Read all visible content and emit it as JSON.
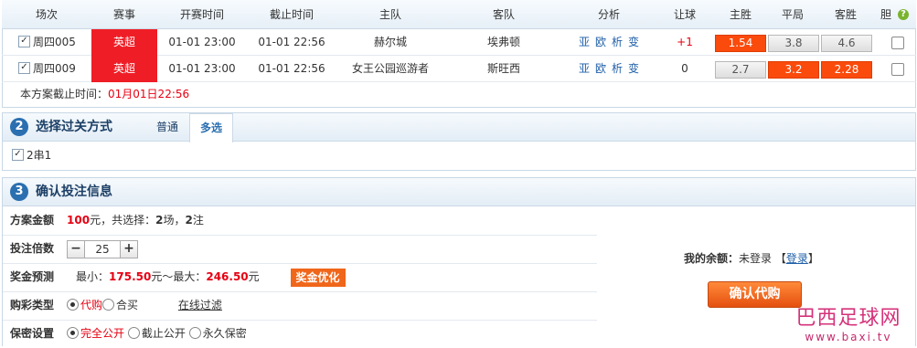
{
  "table": {
    "headers": [
      "场次",
      "赛事",
      "开赛时间",
      "截止时间",
      "主队",
      "客队",
      "分析",
      "让球",
      "主胜",
      "平局",
      "客胜",
      "胆"
    ],
    "rows": [
      {
        "match_no": "周四005",
        "league": "英超",
        "start": "01-01 23:00",
        "deadline": "01-01 22:56",
        "home": "赫尔城",
        "away": "埃弗顿",
        "analysis": [
          "亚",
          "欧",
          "析",
          "变"
        ],
        "handicap": "+1",
        "win": "1.54",
        "draw": "3.8",
        "lose": "4.6",
        "selected": [
          "win"
        ]
      },
      {
        "match_no": "周四009",
        "league": "英超",
        "start": "01-01 23:00",
        "deadline": "01-01 22:56",
        "home": "女王公园巡游者",
        "away": "斯旺西",
        "analysis": [
          "亚",
          "欧",
          "析",
          "变"
        ],
        "handicap": "0",
        "win": "2.7",
        "draw": "3.2",
        "lose": "2.28",
        "selected": [
          "draw",
          "lose"
        ]
      }
    ],
    "deadline_label": "本方案截止时间：",
    "deadline_value": "01月01日22:56"
  },
  "section2": {
    "number": "2",
    "title": "选择过关方式",
    "tabs": [
      "普通",
      "多选"
    ],
    "active_tab": "多选",
    "option": "2串1"
  },
  "section3": {
    "number": "3",
    "title": "确认投注信息",
    "amount_label": "方案金额",
    "amount_value": "100",
    "amount_unit": "元，共选择：",
    "amount_matches": "2",
    "amount_mid": "场，",
    "amount_bets": "2",
    "amount_end": "注",
    "multiple_label": "投注倍数",
    "multiple_value": "25",
    "prize_label": "奖金预测",
    "prize_min_label": "最小：",
    "prize_min": "175.50",
    "prize_mid": "元～最大：",
    "prize_max": "246.50",
    "prize_unit": "元",
    "optimize_button": "奖金优化",
    "type_label": "购彩类型",
    "type_options": [
      "代购",
      "合买"
    ],
    "type_filter": "在线过滤",
    "secret_label": "保密设置",
    "secret_options": [
      "完全公开",
      "截止公开",
      "永久保密"
    ],
    "balance_label": "我的余额：",
    "balance_status": "未登录",
    "login_link": "登录",
    "confirm_button": "确认代购"
  },
  "watermark": {
    "title": "巴西足球网",
    "url": "www.baxi.tv"
  },
  "colors": {
    "accent": "#2b6fb0",
    "red": "#e60012",
    "league": "#ef1d26",
    "odds_selected": "#fa4a0c"
  }
}
